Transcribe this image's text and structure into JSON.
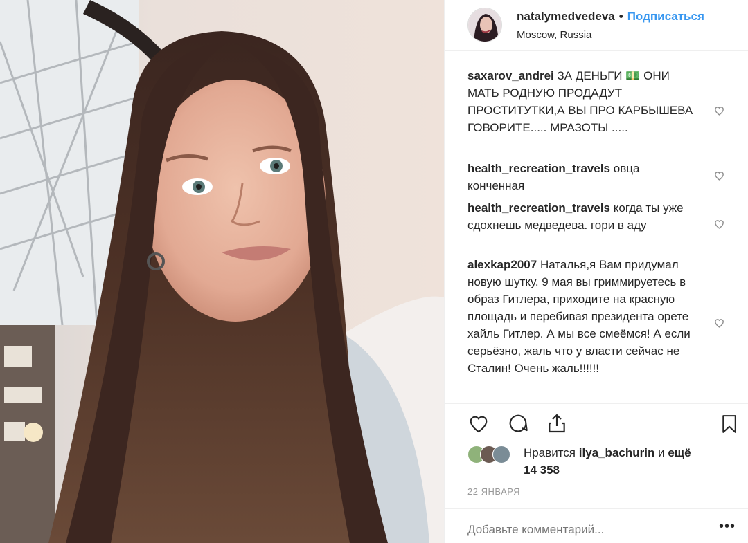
{
  "post": {
    "username": "natalymedvedeva",
    "separator": "•",
    "follow_label": "Подписаться",
    "location": "Moscow, Russia"
  },
  "comments": [
    {
      "author": "saxarov_andrei",
      "text": "ЗА ДЕНЬГИ 💵 ОНИ МАТЬ РОДНУЮ ПРОДАДУТ ПРОСТИТУТКИ,А ВЫ ПРО КАРБЫШЕВА ГОВОРИТЕ..... МРАЗОТЫ ....."
    },
    {
      "author": "health_recreation_travels",
      "text": "овца конченная"
    },
    {
      "author": "health_recreation_travels",
      "text": "когда ты уже сдохнешь медведева. гори в аду"
    },
    {
      "author": "alexkap2007",
      "text": "Наталья,я Вам придумал новую шутку. 9 мая вы гриммируетесь в образ Гитлера, приходите на красную площадь и перебивая президента орете хайль Гитлер. А мы все смеёмся! А если серьёзно, жаль что у власти сейчас не Сталин! Очень жаль!!!!!!"
    }
  ],
  "icons": {
    "like": "heart-icon",
    "comment": "comment-icon",
    "share": "share-icon",
    "save": "bookmark-icon",
    "more": "more-icon"
  },
  "likes": {
    "prefix": "Нравится",
    "user": "ilya_bachurin",
    "connector": "и",
    "more": "ещё 14 358"
  },
  "date": "22 ЯНВАРЯ",
  "add_comment": {
    "placeholder": "Добавьте комментарий...",
    "more_label": "•••"
  },
  "colors": {
    "link": "#3897f0",
    "text": "#262626",
    "muted": "#999999",
    "border": "#efefef"
  }
}
